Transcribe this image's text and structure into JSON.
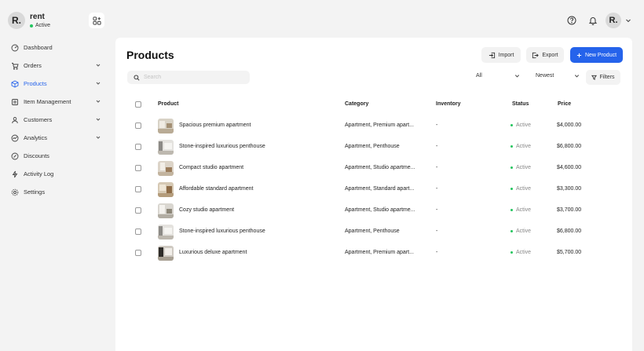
{
  "brand": {
    "avatar": "R.",
    "name": "rent",
    "status": "Active"
  },
  "sidebar": {
    "items": [
      {
        "label": "Dashboard",
        "icon": "dashboard-icon",
        "chevron": false
      },
      {
        "label": "Orders",
        "icon": "cart-icon",
        "chevron": true
      },
      {
        "label": "Products",
        "icon": "box-icon",
        "chevron": true,
        "active": true
      },
      {
        "label": "Item Management",
        "icon": "clipboard-icon",
        "chevron": true
      },
      {
        "label": "Customers",
        "icon": "user-icon",
        "chevron": true
      },
      {
        "label": "Analytics",
        "icon": "analytics-icon",
        "chevron": true
      },
      {
        "label": "Discounts",
        "icon": "discount-icon",
        "chevron": false
      },
      {
        "label": "Activity Log",
        "icon": "activity-icon",
        "chevron": false
      },
      {
        "label": "Settings",
        "icon": "gear-icon",
        "chevron": false
      }
    ]
  },
  "header": {
    "user_avatar": "R."
  },
  "main": {
    "title": "Products",
    "import_label": "Import",
    "export_label": "Export",
    "new_product_label": "New Product",
    "search_placeholder": "Search",
    "category_filter": "All",
    "sort": "Newest",
    "filters_label": "Filters",
    "columns": [
      "Product",
      "Category",
      "Inventory",
      "Status",
      "Price"
    ],
    "rows": [
      {
        "name": "Spacious premium apartment",
        "category": "Apartment, Premium apart...",
        "inventory": "-",
        "status": "Active",
        "price": "$4,000.00"
      },
      {
        "name": "Stone-inspired luxurious penthouse",
        "category": "Apartment, Penthouse",
        "inventory": "-",
        "status": "Active",
        "price": "$6,800.00"
      },
      {
        "name": "Compact studio apartment",
        "category": "Apartment, Studio apartme...",
        "inventory": "-",
        "status": "Active",
        "price": "$4,600.00"
      },
      {
        "name": "Affordable standard apartment",
        "category": "Apartment, Standard apart...",
        "inventory": "-",
        "status": "Active",
        "price": "$3,300.00"
      },
      {
        "name": "Cozy studio apartment",
        "category": "Apartment, Studio apartme...",
        "inventory": "-",
        "status": "Active",
        "price": "$3,700.00"
      },
      {
        "name": "Stone-inspired luxurious penthouse",
        "category": "Apartment, Penthouse",
        "inventory": "-",
        "status": "Active",
        "price": "$6,800.00"
      },
      {
        "name": "Luxurious deluxe apartment",
        "category": "Apartment, Premium apart...",
        "inventory": "-",
        "status": "Active",
        "price": "$5,700.00"
      }
    ]
  },
  "colors": {
    "accent": "#2563eb",
    "active_dot": "#22c55e",
    "background": "#f3f3f3"
  }
}
